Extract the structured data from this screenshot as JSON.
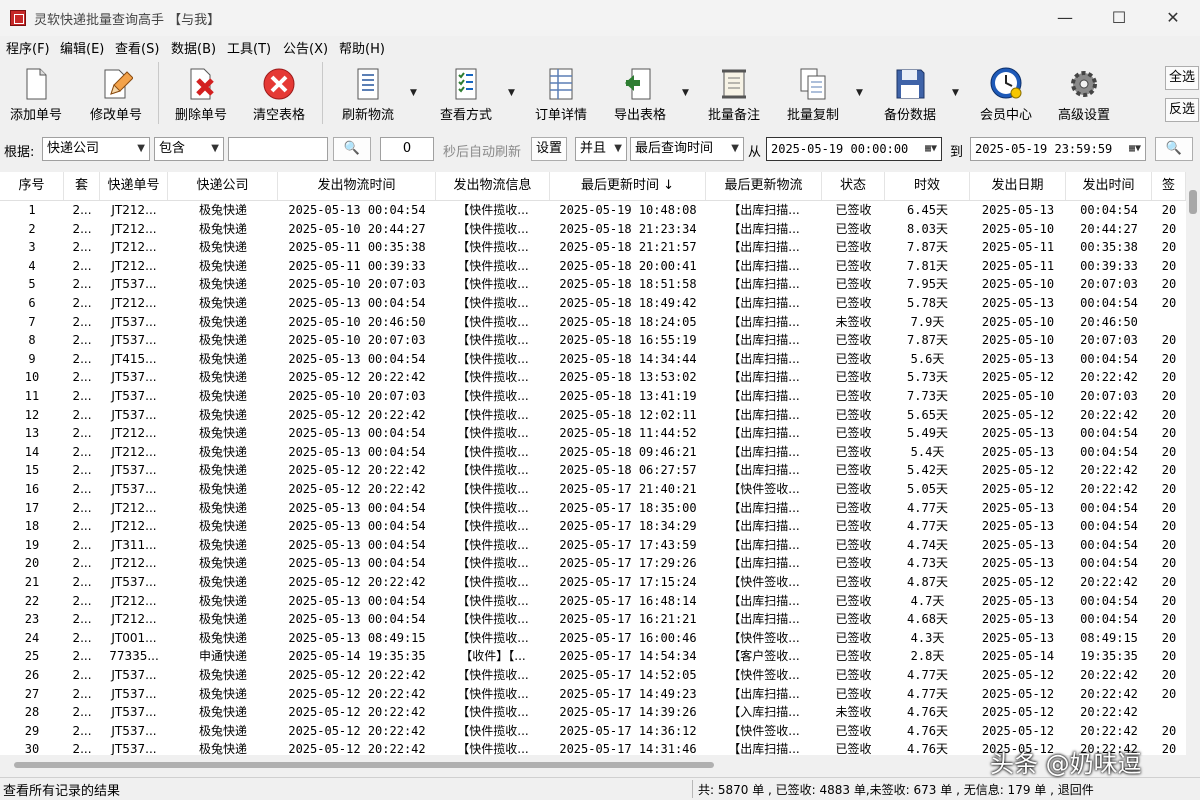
{
  "window": {
    "title": "灵软快递批量查询高手 【与我】",
    "minimize": "—",
    "maximize": "☐",
    "close": "✕"
  },
  "menu": [
    "程序(F)",
    "编辑(E)",
    "查看(S)",
    "数据(B)",
    "工具(T)",
    "公告(X)",
    "帮助(H)"
  ],
  "toolbar": {
    "add": "添加单号",
    "edit": "修改单号",
    "delete": "删除单号",
    "clear": "清空表格",
    "refresh": "刷新物流",
    "view": "查看方式",
    "detail": "订单详情",
    "export": "导出表格",
    "note": "批量备注",
    "copy": "批量复制",
    "backup": "备份数据",
    "member": "会员中心",
    "settings": "高级设置",
    "select_all": "全选",
    "invert": "反选"
  },
  "filter": {
    "label": "根据:",
    "field": "快递公司",
    "op": "包含",
    "value": "",
    "search_glyph": "🔍",
    "interval": "0",
    "auto_refresh": "秒后自动刷新",
    "set": "设置",
    "logic": "并且",
    "time_field": "最后查询时间",
    "from": "从",
    "start": "2025-05-19 00:00:00",
    "to": "到",
    "end": "2025-05-19 23:59:59"
  },
  "table": {
    "headers": [
      "序号",
      "套",
      "快递单号",
      "快递公司",
      "发出物流时间",
      "发出物流信息",
      "最后更新时间 ↓",
      "最后更新物流",
      "状态",
      "时效",
      "发出日期",
      "发出时间",
      "签"
    ],
    "rows": [
      [
        "1",
        "2...",
        "JT212...",
        "极兔快递",
        "2025-05-13 00:04:54",
        "【快件揽收...",
        "2025-05-19 10:48:08",
        "【出库扫描...",
        "已签收",
        "6.45天",
        "2025-05-13",
        "00:04:54",
        "20"
      ],
      [
        "2",
        "2...",
        "JT212...",
        "极兔快递",
        "2025-05-10 20:44:27",
        "【快件揽收...",
        "2025-05-18 21:23:34",
        "【出库扫描...",
        "已签收",
        "8.03天",
        "2025-05-10",
        "20:44:27",
        "20"
      ],
      [
        "3",
        "2...",
        "JT212...",
        "极兔快递",
        "2025-05-11 00:35:38",
        "【快件揽收...",
        "2025-05-18 21:21:57",
        "【出库扫描...",
        "已签收",
        "7.87天",
        "2025-05-11",
        "00:35:38",
        "20"
      ],
      [
        "4",
        "2...",
        "JT212...",
        "极兔快递",
        "2025-05-11 00:39:33",
        "【快件揽收...",
        "2025-05-18 20:00:41",
        "【出库扫描...",
        "已签收",
        "7.81天",
        "2025-05-11",
        "00:39:33",
        "20"
      ],
      [
        "5",
        "2...",
        "JT537...",
        "极兔快递",
        "2025-05-10 20:07:03",
        "【快件揽收...",
        "2025-05-18 18:51:58",
        "【出库扫描...",
        "已签收",
        "7.95天",
        "2025-05-10",
        "20:07:03",
        "20"
      ],
      [
        "6",
        "2...",
        "JT212...",
        "极兔快递",
        "2025-05-13 00:04:54",
        "【快件揽收...",
        "2025-05-18 18:49:42",
        "【出库扫描...",
        "已签收",
        "5.78天",
        "2025-05-13",
        "00:04:54",
        "20"
      ],
      [
        "7",
        "2...",
        "JT537...",
        "极兔快递",
        "2025-05-10 20:46:50",
        "【快件揽收...",
        "2025-05-18 18:24:05",
        "【出库扫描...",
        "未签收",
        "7.9天",
        "2025-05-10",
        "20:46:50",
        ""
      ],
      [
        "8",
        "2...",
        "JT537...",
        "极兔快递",
        "2025-05-10 20:07:03",
        "【快件揽收...",
        "2025-05-18 16:55:19",
        "【出库扫描...",
        "已签收",
        "7.87天",
        "2025-05-10",
        "20:07:03",
        "20"
      ],
      [
        "9",
        "2...",
        "JT415...",
        "极兔快递",
        "2025-05-13 00:04:54",
        "【快件揽收...",
        "2025-05-18 14:34:44",
        "【出库扫描...",
        "已签收",
        "5.6天",
        "2025-05-13",
        "00:04:54",
        "20"
      ],
      [
        "10",
        "2...",
        "JT537...",
        "极兔快递",
        "2025-05-12 20:22:42",
        "【快件揽收...",
        "2025-05-18 13:53:02",
        "【出库扫描...",
        "已签收",
        "5.73天",
        "2025-05-12",
        "20:22:42",
        "20"
      ],
      [
        "11",
        "2...",
        "JT537...",
        "极兔快递",
        "2025-05-10 20:07:03",
        "【快件揽收...",
        "2025-05-18 13:41:19",
        "【出库扫描...",
        "已签收",
        "7.73天",
        "2025-05-10",
        "20:07:03",
        "20"
      ],
      [
        "12",
        "2...",
        "JT537...",
        "极兔快递",
        "2025-05-12 20:22:42",
        "【快件揽收...",
        "2025-05-18 12:02:11",
        "【出库扫描...",
        "已签收",
        "5.65天",
        "2025-05-12",
        "20:22:42",
        "20"
      ],
      [
        "13",
        "2...",
        "JT212...",
        "极兔快递",
        "2025-05-13 00:04:54",
        "【快件揽收...",
        "2025-05-18 11:44:52",
        "【出库扫描...",
        "已签收",
        "5.49天",
        "2025-05-13",
        "00:04:54",
        "20"
      ],
      [
        "14",
        "2...",
        "JT212...",
        "极兔快递",
        "2025-05-13 00:04:54",
        "【快件揽收...",
        "2025-05-18 09:46:21",
        "【出库扫描...",
        "已签收",
        "5.4天",
        "2025-05-13",
        "00:04:54",
        "20"
      ],
      [
        "15",
        "2...",
        "JT537...",
        "极兔快递",
        "2025-05-12 20:22:42",
        "【快件揽收...",
        "2025-05-18 06:27:57",
        "【出库扫描...",
        "已签收",
        "5.42天",
        "2025-05-12",
        "20:22:42",
        "20"
      ],
      [
        "16",
        "2...",
        "JT537...",
        "极兔快递",
        "2025-05-12 20:22:42",
        "【快件揽收...",
        "2025-05-17 21:40:21",
        "【快件签收...",
        "已签收",
        "5.05天",
        "2025-05-12",
        "20:22:42",
        "20"
      ],
      [
        "17",
        "2...",
        "JT212...",
        "极兔快递",
        "2025-05-13 00:04:54",
        "【快件揽收...",
        "2025-05-17 18:35:00",
        "【出库扫描...",
        "已签收",
        "4.77天",
        "2025-05-13",
        "00:04:54",
        "20"
      ],
      [
        "18",
        "2...",
        "JT212...",
        "极兔快递",
        "2025-05-13 00:04:54",
        "【快件揽收...",
        "2025-05-17 18:34:29",
        "【出库扫描...",
        "已签收",
        "4.77天",
        "2025-05-13",
        "00:04:54",
        "20"
      ],
      [
        "19",
        "2...",
        "JT311...",
        "极兔快递",
        "2025-05-13 00:04:54",
        "【快件揽收...",
        "2025-05-17 17:43:59",
        "【出库扫描...",
        "已签收",
        "4.74天",
        "2025-05-13",
        "00:04:54",
        "20"
      ],
      [
        "20",
        "2...",
        "JT212...",
        "极兔快递",
        "2025-05-13 00:04:54",
        "【快件揽收...",
        "2025-05-17 17:29:26",
        "【出库扫描...",
        "已签收",
        "4.73天",
        "2025-05-13",
        "00:04:54",
        "20"
      ],
      [
        "21",
        "2...",
        "JT537...",
        "极兔快递",
        "2025-05-12 20:22:42",
        "【快件揽收...",
        "2025-05-17 17:15:24",
        "【快件签收...",
        "已签收",
        "4.87天",
        "2025-05-12",
        "20:22:42",
        "20"
      ],
      [
        "22",
        "2...",
        "JT212...",
        "极兔快递",
        "2025-05-13 00:04:54",
        "【快件揽收...",
        "2025-05-17 16:48:14",
        "【出库扫描...",
        "已签收",
        "4.7天",
        "2025-05-13",
        "00:04:54",
        "20"
      ],
      [
        "23",
        "2...",
        "JT212...",
        "极兔快递",
        "2025-05-13 00:04:54",
        "【快件揽收...",
        "2025-05-17 16:21:21",
        "【出库扫描...",
        "已签收",
        "4.68天",
        "2025-05-13",
        "00:04:54",
        "20"
      ],
      [
        "24",
        "2...",
        "JT001...",
        "极兔快递",
        "2025-05-13 08:49:15",
        "【快件揽收...",
        "2025-05-17 16:00:46",
        "【快件签收...",
        "已签收",
        "4.3天",
        "2025-05-13",
        "08:49:15",
        "20"
      ],
      [
        "25",
        "2...",
        "77335...",
        "申通快递",
        "2025-05-14 19:35:35",
        "【收件】【...",
        "2025-05-17 14:54:34",
        "【客户签收...",
        "已签收",
        "2.8天",
        "2025-05-14",
        "19:35:35",
        "20"
      ],
      [
        "26",
        "2...",
        "JT537...",
        "极兔快递",
        "2025-05-12 20:22:42",
        "【快件揽收...",
        "2025-05-17 14:52:05",
        "【快件签收...",
        "已签收",
        "4.77天",
        "2025-05-12",
        "20:22:42",
        "20"
      ],
      [
        "27",
        "2...",
        "JT537...",
        "极兔快递",
        "2025-05-12 20:22:42",
        "【快件揽收...",
        "2025-05-17 14:49:23",
        "【出库扫描...",
        "已签收",
        "4.77天",
        "2025-05-12",
        "20:22:42",
        "20"
      ],
      [
        "28",
        "2...",
        "JT537...",
        "极兔快递",
        "2025-05-12 20:22:42",
        "【快件揽收...",
        "2025-05-17 14:39:26",
        "【入库扫描...",
        "未签收",
        "4.76天",
        "2025-05-12",
        "20:22:42",
        ""
      ],
      [
        "29",
        "2...",
        "JT537...",
        "极兔快递",
        "2025-05-12 20:22:42",
        "【快件揽收...",
        "2025-05-17 14:36:12",
        "【快件签收...",
        "已签收",
        "4.76天",
        "2025-05-12",
        "20:22:42",
        "20"
      ],
      [
        "30",
        "2...",
        "JT537...",
        "极兔快递",
        "2025-05-12 20:22:42",
        "【快件揽收...",
        "2025-05-17 14:31:46",
        "【出库扫描...",
        "已签收",
        "4.76天",
        "2025-05-12",
        "20:22:42",
        "20"
      ]
    ]
  },
  "status": {
    "left": "查看所有记录的结果",
    "right": "共: 5870 单 , 已签收:  4883 单,未签收:  673 单 , 无信息: 179 单 , 退回件"
  },
  "watermark": "头条 @奶味逗"
}
